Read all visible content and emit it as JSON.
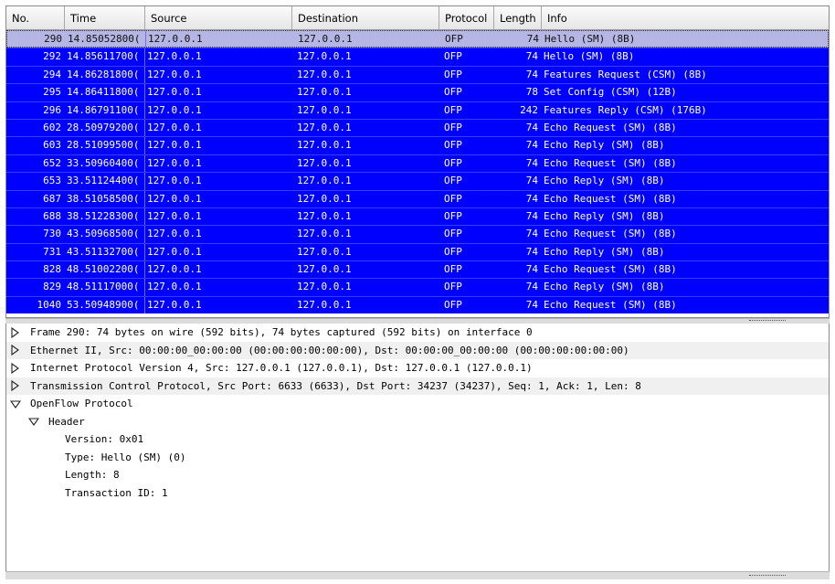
{
  "columns": {
    "no": "No.",
    "time": "Time",
    "source": "Source",
    "destination": "Destination",
    "protocol": "Protocol",
    "length": "Length",
    "info": "Info"
  },
  "packets": [
    {
      "no": "290",
      "time": "14.85052800(",
      "source": "127.0.0.1",
      "destination": "127.0.0.1",
      "protocol": "OFP",
      "length": "74",
      "info": "Hello (SM) (8B)",
      "selected": true
    },
    {
      "no": "292",
      "time": "14.85611700(",
      "source": "127.0.0.1",
      "destination": "127.0.0.1",
      "protocol": "OFP",
      "length": "74",
      "info": "Hello (SM) (8B)"
    },
    {
      "no": "294",
      "time": "14.86281800(",
      "source": "127.0.0.1",
      "destination": "127.0.0.1",
      "protocol": "OFP",
      "length": "74",
      "info": "Features Request (CSM) (8B)"
    },
    {
      "no": "295",
      "time": "14.86411800(",
      "source": "127.0.0.1",
      "destination": "127.0.0.1",
      "protocol": "OFP",
      "length": "78",
      "info": "Set Config (CSM) (12B)"
    },
    {
      "no": "296",
      "time": "14.86791100(",
      "source": "127.0.0.1",
      "destination": "127.0.0.1",
      "protocol": "OFP",
      "length": "242",
      "info": "Features Reply (CSM) (176B)"
    },
    {
      "no": "602",
      "time": "28.50979200(",
      "source": "127.0.0.1",
      "destination": "127.0.0.1",
      "protocol": "OFP",
      "length": "74",
      "info": "Echo Request (SM) (8B)"
    },
    {
      "no": "603",
      "time": "28.51099500(",
      "source": "127.0.0.1",
      "destination": "127.0.0.1",
      "protocol": "OFP",
      "length": "74",
      "info": "Echo Reply (SM) (8B)"
    },
    {
      "no": "652",
      "time": "33.50960400(",
      "source": "127.0.0.1",
      "destination": "127.0.0.1",
      "protocol": "OFP",
      "length": "74",
      "info": "Echo Request (SM) (8B)"
    },
    {
      "no": "653",
      "time": "33.51124400(",
      "source": "127.0.0.1",
      "destination": "127.0.0.1",
      "protocol": "OFP",
      "length": "74",
      "info": "Echo Reply (SM) (8B)"
    },
    {
      "no": "687",
      "time": "38.51058500(",
      "source": "127.0.0.1",
      "destination": "127.0.0.1",
      "protocol": "OFP",
      "length": "74",
      "info": "Echo Request (SM) (8B)"
    },
    {
      "no": "688",
      "time": "38.51228300(",
      "source": "127.0.0.1",
      "destination": "127.0.0.1",
      "protocol": "OFP",
      "length": "74",
      "info": "Echo Reply (SM) (8B)"
    },
    {
      "no": "730",
      "time": "43.50968500(",
      "source": "127.0.0.1",
      "destination": "127.0.0.1",
      "protocol": "OFP",
      "length": "74",
      "info": "Echo Request (SM) (8B)"
    },
    {
      "no": "731",
      "time": "43.51132700(",
      "source": "127.0.0.1",
      "destination": "127.0.0.1",
      "protocol": "OFP",
      "length": "74",
      "info": "Echo Reply (SM) (8B)"
    },
    {
      "no": "828",
      "time": "48.51002200(",
      "source": "127.0.0.1",
      "destination": "127.0.0.1",
      "protocol": "OFP",
      "length": "74",
      "info": "Echo Request (SM) (8B)"
    },
    {
      "no": "829",
      "time": "48.51117000(",
      "source": "127.0.0.1",
      "destination": "127.0.0.1",
      "protocol": "OFP",
      "length": "74",
      "info": "Echo Reply (SM) (8B)"
    },
    {
      "no": "1040",
      "time": "53.50948900(",
      "source": "127.0.0.1",
      "destination": "127.0.0.1",
      "protocol": "OFP",
      "length": "74",
      "info": "Echo Request (SM) (8B)"
    }
  ],
  "details": {
    "frame": "Frame 290: 74 bytes on wire (592 bits), 74 bytes captured (592 bits) on interface 0",
    "ethernet": "Ethernet II, Src: 00:00:00_00:00:00 (00:00:00:00:00:00), Dst: 00:00:00_00:00:00 (00:00:00:00:00:00)",
    "ip": "Internet Protocol Version 4, Src: 127.0.0.1 (127.0.0.1), Dst: 127.0.0.1 (127.0.0.1)",
    "tcp": "Transmission Control Protocol, Src Port: 6633 (6633), Dst Port: 34237 (34237), Seq: 1, Ack: 1, Len: 8",
    "openflow": "OpenFlow Protocol",
    "header": "Header",
    "version": "Version: 0x01",
    "type": "Type: Hello (SM) (0)",
    "length": "Length: 8",
    "xid": "Transaction ID: 1"
  },
  "icons": {
    "collapsed": "triangle-right-icon",
    "expanded": "triangle-down-icon"
  },
  "colors": {
    "row_bg": "#0000ff",
    "row_fg": "#ffffff",
    "selected_bg": "#b6b6e4"
  }
}
